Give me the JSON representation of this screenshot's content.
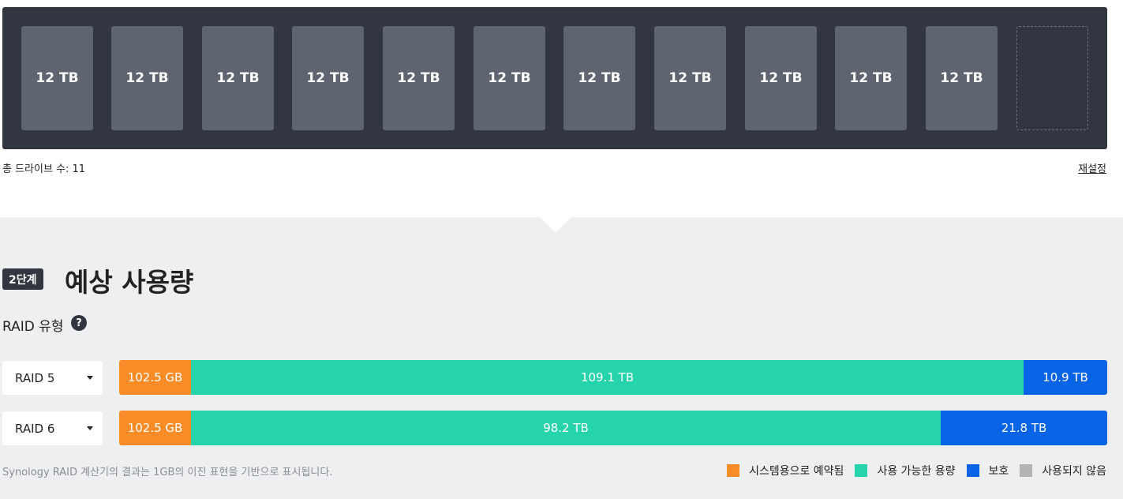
{
  "drives": {
    "slots": [
      "12 TB",
      "12 TB",
      "12 TB",
      "12 TB",
      "12 TB",
      "12 TB",
      "12 TB",
      "12 TB",
      "12 TB",
      "12 TB",
      "12 TB",
      ""
    ],
    "count_label": "총 드라이브 수: 11",
    "reset_label": "재설정"
  },
  "step": {
    "badge": "2단계",
    "title": "예상 사용량"
  },
  "raid_type": {
    "label": "RAID 유형",
    "help": "?"
  },
  "colors": {
    "reserved": "#fa8c28",
    "available": "#26d4ab",
    "protection": "#0864e6",
    "unused": "#b4b4b4"
  },
  "raid_rows": [
    {
      "select": "RAID 5",
      "segments": [
        {
          "kind": "reserved",
          "label": "102.5 GB",
          "fraction": 0.0727
        },
        {
          "kind": "available",
          "label": "109.1 TB",
          "fraction": 0.8427
        },
        {
          "kind": "protection",
          "label": "10.9 TB",
          "fraction": 0.0846
        }
      ]
    },
    {
      "select": "RAID 6",
      "segments": [
        {
          "kind": "reserved",
          "label": "102.5 GB",
          "fraction": 0.0727
        },
        {
          "kind": "available",
          "label": "98.2 TB",
          "fraction": 0.7588
        },
        {
          "kind": "protection",
          "label": "21.8 TB",
          "fraction": 0.1685
        }
      ]
    }
  ],
  "footnote": "Synology RAID 계산기의 결과는 1GB의 이진 표현을 기반으로 표시됩니다.",
  "legend": [
    {
      "kind": "reserved",
      "label": "시스템용으로 예약됨"
    },
    {
      "kind": "available",
      "label": "사용 가능한 용량"
    },
    {
      "kind": "protection",
      "label": "보호"
    },
    {
      "kind": "unused",
      "label": "사용되지 않음"
    }
  ]
}
